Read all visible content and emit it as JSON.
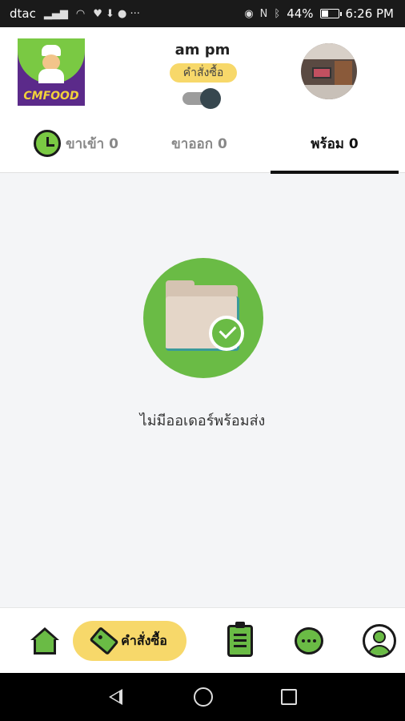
{
  "status_bar": {
    "carrier": "dtac",
    "battery": "44%",
    "battery_level": 0.44,
    "time": "6:26 PM"
  },
  "header": {
    "logo_text": "CMFOOD",
    "shop_name": "am pm",
    "order_badge": "คำสั่งซื้อ",
    "toggle_on": true
  },
  "tabs": [
    {
      "label": "ขาเข้า 0",
      "active": false
    },
    {
      "label": "ขาออก 0",
      "active": false
    },
    {
      "label": "พร้อม 0",
      "active": true
    }
  ],
  "empty_state": {
    "message": "ไม่มีออเดอร์พร้อมส่ง"
  },
  "bottom_nav": {
    "orders_label": "คำสั่งซื้อ"
  },
  "colors": {
    "brand_green": "#6abb45",
    "accent_yellow": "#f7d86a",
    "logo_purple": "#5b2a8a"
  }
}
